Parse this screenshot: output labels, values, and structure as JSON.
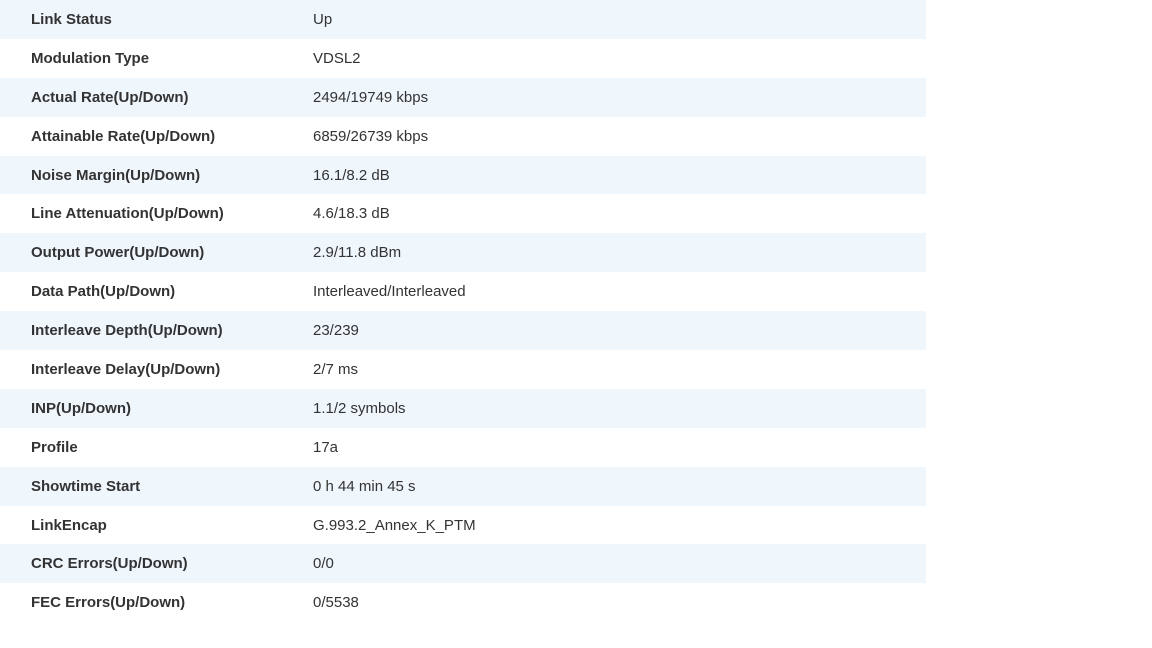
{
  "dsl_status": {
    "rows": [
      {
        "label": "Link Status",
        "value": "Up"
      },
      {
        "label": "Modulation Type",
        "value": "VDSL2"
      },
      {
        "label": "Actual Rate(Up/Down)",
        "value": "2494/19749 kbps"
      },
      {
        "label": "Attainable Rate(Up/Down)",
        "value": "6859/26739 kbps"
      },
      {
        "label": "Noise Margin(Up/Down)",
        "value": "16.1/8.2 dB"
      },
      {
        "label": "Line Attenuation(Up/Down)",
        "value": "4.6/18.3 dB"
      },
      {
        "label": "Output Power(Up/Down)",
        "value": "2.9/11.8 dBm"
      },
      {
        "label": "Data Path(Up/Down)",
        "value": "Interleaved/Interleaved"
      },
      {
        "label": "Interleave Depth(Up/Down)",
        "value": "23/239"
      },
      {
        "label": "Interleave Delay(Up/Down)",
        "value": "2/7 ms"
      },
      {
        "label": "INP(Up/Down)",
        "value": "1.1/2 symbols"
      },
      {
        "label": "Profile",
        "value": "17a"
      },
      {
        "label": "Showtime Start",
        "value": "0 h 44 min 45 s"
      },
      {
        "label": "LinkEncap",
        "value": "G.993.2_Annex_K_PTM"
      },
      {
        "label": "CRC Errors(Up/Down)",
        "value": "0/0"
      },
      {
        "label": "FEC Errors(Up/Down)",
        "value": "0/5538"
      }
    ]
  }
}
